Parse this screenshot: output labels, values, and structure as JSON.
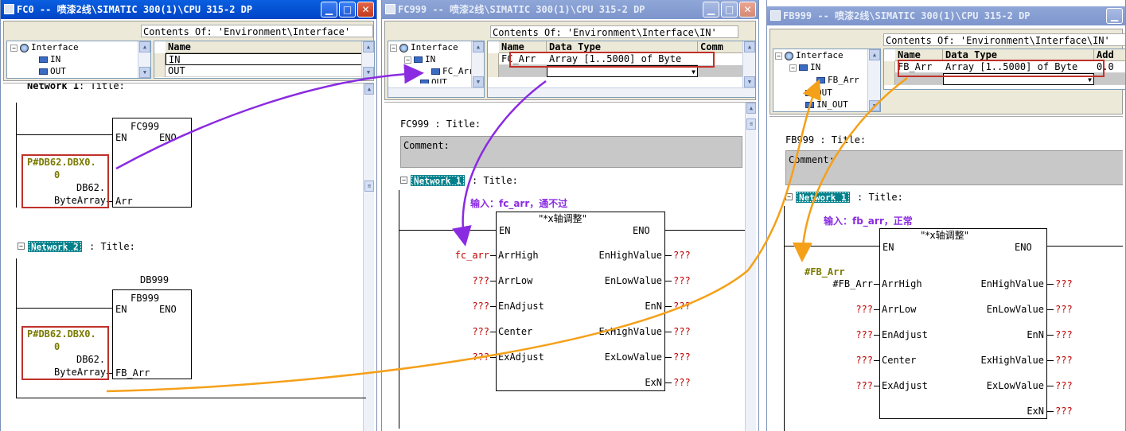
{
  "colors": {
    "purple_arrow": "#8a2be2",
    "orange_arrow": "#f5a019",
    "highlight": "#c0302a",
    "param_red": "#c00000",
    "network_teal": "#00808a"
  },
  "icons": {
    "minimize": "minimize-icon",
    "maximize": "maximize-icon",
    "close": "close-icon"
  },
  "win1": {
    "title": "FC0 -- 喷漆2线\\SIMATIC 300(1)\\CPU 315-2 DP",
    "contents": "Contents Of: 'Environment\\Interface'",
    "tree": [
      "Interface",
      "IN",
      "OUT"
    ],
    "grid": {
      "header": "Name",
      "rows": [
        "IN",
        "OUT"
      ]
    },
    "network1": {
      "label": "Network 1",
      "title": ": Title:"
    },
    "block1": {
      "name": "FC999",
      "en": "EN",
      "eno": "ENO",
      "param": "Arr",
      "arg": [
        "P#DB62.DBX0.",
        "0",
        "DB62.",
        "ByteArray"
      ]
    },
    "network2": {
      "label": "Network 2",
      "title": ": Title:"
    },
    "block2": {
      "db": "DB999",
      "name": "FB999",
      "en": "EN",
      "eno": "ENO",
      "param": "FB_Arr",
      "arg": [
        "P#DB62.DBX0.",
        "0",
        "DB62.",
        "ByteArray"
      ]
    }
  },
  "win2": {
    "title": "FC999 -- 喷漆2线\\SIMATIC 300(1)\\CPU 315-2 DP",
    "contents": "Contents Of: 'Environment\\Interface\\IN'",
    "tree": [
      "Interface",
      "IN",
      "FC_Arr",
      "OUT"
    ],
    "grid": {
      "headers": [
        "Name",
        "Data Type",
        "Comm"
      ],
      "row": {
        "name": "FC_Arr",
        "type": "Array [1..5000] of Byte"
      }
    },
    "block_title": "FC999 : Title:",
    "comment": "Comment:",
    "network1": {
      "label": "Network 1",
      "title": ": Title:"
    },
    "note": "输入：fc_arr，通不过",
    "fb": {
      "name": "\"*x轴调整\"",
      "en": "EN",
      "eno": "ENO",
      "inputs": [
        {
          "arg": "fc_arr",
          "pin": "ArrHigh"
        },
        {
          "arg": "???",
          "pin": "ArrLow"
        },
        {
          "arg": "???",
          "pin": "EnAdjust"
        },
        {
          "arg": "???",
          "pin": "Center"
        },
        {
          "arg": "???",
          "pin": "ExAdjust"
        }
      ],
      "outputs": [
        {
          "pin": "EnHighValue",
          "arg": "???"
        },
        {
          "pin": "EnLowValue",
          "arg": "???"
        },
        {
          "pin": "EnN",
          "arg": "???"
        },
        {
          "pin": "ExHighValue",
          "arg": "???"
        },
        {
          "pin": "ExLowValue",
          "arg": "???"
        },
        {
          "pin": "ExN",
          "arg": "???"
        }
      ]
    }
  },
  "win3": {
    "title": "FB999 -- 喷漆2线\\SIMATIC 300(1)\\CPU 315-2 DP",
    "contents": "Contents Of: 'Environment\\Interface\\IN'",
    "tree": [
      "Interface",
      "IN",
      "FB_Arr",
      "OUT",
      "IN_OUT"
    ],
    "grid": {
      "headers": [
        "Name",
        "Data Type",
        "Add"
      ],
      "row": {
        "name": "FB_Arr",
        "type": "Array [1..5000] of Byte",
        "addr": "0.0"
      }
    },
    "block_title": "FB999 : Title:",
    "comment": "Comment:",
    "network1": {
      "label": "Network 1",
      "title": ": Title:"
    },
    "note": "输入：fb_arr，正常",
    "arg_label": "#FB_Arr",
    "fb": {
      "name": "\"*x轴调整\"",
      "en": "EN",
      "eno": "ENO",
      "inputs": [
        {
          "arg": "#FB_Arr",
          "pin": "ArrHigh"
        },
        {
          "arg": "???",
          "pin": "ArrLow"
        },
        {
          "arg": "???",
          "pin": "EnAdjust"
        },
        {
          "arg": "???",
          "pin": "Center"
        },
        {
          "arg": "???",
          "pin": "ExAdjust"
        }
      ],
      "outputs": [
        {
          "pin": "EnHighValue",
          "arg": "???"
        },
        {
          "pin": "EnLowValue",
          "arg": "???"
        },
        {
          "pin": "EnN",
          "arg": "???"
        },
        {
          "pin": "ExHighValue",
          "arg": "???"
        },
        {
          "pin": "ExLowValue",
          "arg": "???"
        },
        {
          "pin": "ExN",
          "arg": "???"
        }
      ]
    }
  }
}
